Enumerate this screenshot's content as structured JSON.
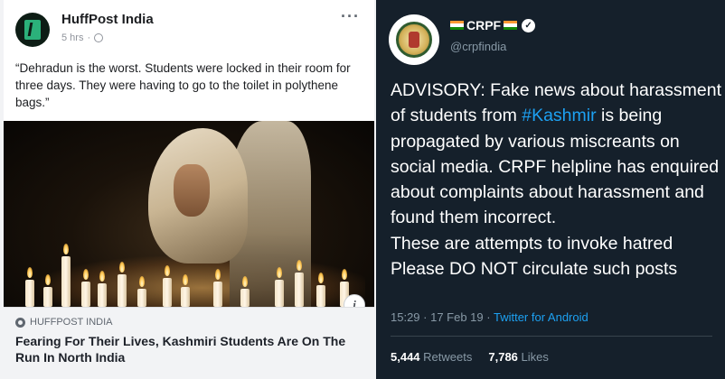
{
  "facebook_post": {
    "page_name": "HuffPost India",
    "time": "5 hrs",
    "separator": "·",
    "more_label": "···",
    "post_text": "“Dehradun is the worst. Students were locked in their room for three days. They were having to go to the toilet in polythene bags.”",
    "info_icon": "i",
    "link_source": "HUFFPOST INDIA",
    "link_title": "Fearing For Their Lives, Kashmiri Students Are On The Run In North India"
  },
  "tweet": {
    "display_name": "CRPF",
    "handle": "@crpfindia",
    "verified_glyph": "✓",
    "text_before_hashtag": "ADVISORY: Fake news about harassment of students from ",
    "hashtag": "#Kashmir",
    "text_after_hashtag": " is being propagated by various miscreants on social media. CRPF helpline has  enquired about complaints about harassment and found them incorrect.\nThese are attempts to invoke hatred\nPlease DO NOT circulate such posts",
    "timestamp": "15:29 · 17 Feb 19",
    "meta_separator": " · ",
    "source": "Twitter for Android",
    "retweets_count": "5,444",
    "retweets_label": "Retweets",
    "likes_count": "7,786",
    "likes_label": "Likes"
  },
  "colors": {
    "twitter_bg": "#15202b",
    "twitter_link": "#1da1f2",
    "facebook_text": "#1c1e21",
    "flag_saffron": "#ff9933",
    "flag_white": "#ffffff",
    "flag_green": "#138808"
  },
  "icons": {
    "facebook_avatar": "huffpost-logo-icon",
    "facebook_privacy": "globe-icon",
    "facebook_more": "more-options-icon",
    "tweet_avatar": "crpf-emblem-icon",
    "tweet_flags": "india-flag-icon",
    "tweet_verified": "verified-badge-icon"
  }
}
